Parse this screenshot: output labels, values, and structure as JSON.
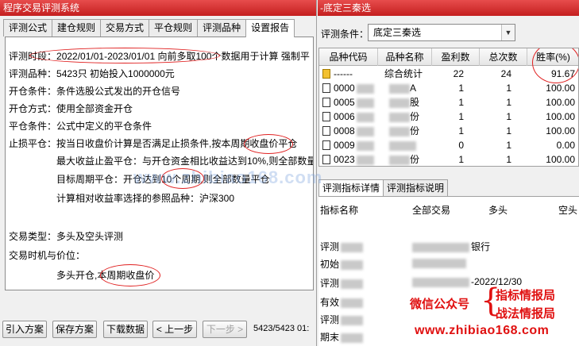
{
  "left_window": {
    "title": "程序交易评测系统",
    "tabs": [
      "评测公式",
      "建仓规则",
      "交易方式",
      "平仓规则",
      "评测品种",
      "设置报告"
    ],
    "report": {
      "period_label": "评测时段：",
      "period_value": "2022/01/01-2023/01/01 向前多取100个数据用于计算 强制平",
      "variety_label": "评测品种：",
      "variety_value": "5423只 初始投入1000000元",
      "open_label": "开仓条件：",
      "open_value": "条件选股公式发出的开仓信号",
      "mode_label": "开仓方式：",
      "mode_value": "使用全部资金开仓",
      "close_label": "平仓条件：",
      "close_value": "公式中定义的平仓条件",
      "stop_label": "止损平仓：",
      "stop_value": "按当日收盘价计算是否满足止损条件,按本周期收盘价平仓",
      "profit_stop": "最大收益止盈平仓：与开仓资金相比收益达到10%,则全部数量",
      "target_cycle": "目标周期平仓：开仓达到10个周期,则全部数量平仓",
      "benchmark": "计算相对收益率选择的参照品种：沪深300",
      "trade_type_label": "交易类型：",
      "trade_type_value": "多头及空头评测",
      "timing_label": "交易时机与价位：",
      "timing_value": "多头开仓,本周期收盘价"
    },
    "buttons": {
      "import": "引入方案",
      "save": "保存方案",
      "download": "下载数据",
      "prev": "< 上一步",
      "next": "下一步 >"
    },
    "status": "5423/5423 01:"
  },
  "right_window": {
    "title": "-底定三秦选",
    "condition_label": "评测条件：",
    "condition_value": "底定三秦选",
    "table": {
      "headers": [
        "品种代码",
        "品种名称",
        "盈利数",
        "总次数",
        "胜率(%)"
      ],
      "rows": [
        {
          "code": "------",
          "name": "综合统计",
          "wins": "22",
          "total": "24",
          "rate": "91.67"
        },
        {
          "code": "0000",
          "name": "A",
          "wins": "1",
          "total": "1",
          "rate": "100.00"
        },
        {
          "code": "0005",
          "name": "股",
          "wins": "1",
          "total": "1",
          "rate": "100.00"
        },
        {
          "code": "0006",
          "name": "份",
          "wins": "1",
          "total": "1",
          "rate": "100.00"
        },
        {
          "code": "0008",
          "name": "份",
          "wins": "1",
          "total": "1",
          "rate": "100.00"
        },
        {
          "code": "0009",
          "name": "",
          "wins": "0",
          "total": "1",
          "rate": "0.00"
        },
        {
          "code": "0023",
          "name": "份",
          "wins": "1",
          "total": "1",
          "rate": "100.00"
        }
      ]
    },
    "lower_tabs": [
      "评测指标详情",
      "评测指标说明"
    ],
    "detail": {
      "headers": [
        "指标名称",
        "全部交易",
        "多头",
        "空头"
      ],
      "rows": [
        {
          "name": "评测",
          "value": "银行"
        },
        {
          "name": "初始",
          "value": ""
        },
        {
          "name": "评测",
          "value": "-2022/12/30"
        },
        {
          "name": "有效",
          "value": ""
        },
        {
          "name": "评测",
          "value": ""
        },
        {
          "name": "期末",
          "value": ""
        }
      ]
    }
  },
  "watermark": {
    "center": "www.zhibiao168.com",
    "gzh": "微信公众号",
    "line1": "指标情报局",
    "line2": "战法情报局",
    "url": "www.zhibiao168.com"
  }
}
